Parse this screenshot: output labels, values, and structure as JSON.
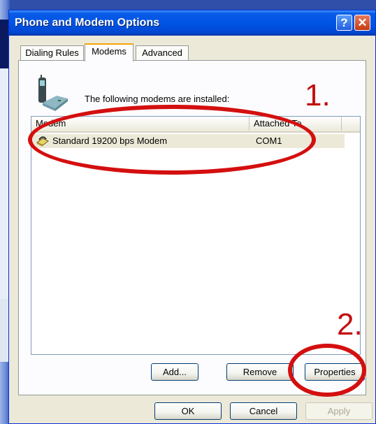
{
  "window": {
    "title": "Phone and Modem Options",
    "help_glyph": "?",
    "close_glyph": "✕"
  },
  "tabs": [
    {
      "label": "Dialing Rules",
      "active": false
    },
    {
      "label": "Modems",
      "active": true
    },
    {
      "label": "Advanced",
      "active": false
    }
  ],
  "modems_panel": {
    "intro": "The following modems are  installed:",
    "columns": [
      "Modem",
      "Attached To"
    ],
    "rows": [
      {
        "modem": "Standard 19200 bps Modem",
        "attached_to": "COM1",
        "icon": "modem-icon"
      }
    ],
    "buttons": {
      "add": "Add...",
      "remove": "Remove",
      "properties": "Properties"
    }
  },
  "dialog_buttons": {
    "ok": "OK",
    "cancel": "Cancel",
    "apply": "Apply"
  },
  "annotations": {
    "step1": "1.",
    "step2": "2.",
    "color": "#d40f0f"
  },
  "icons": {
    "top": "phone-modem-icon"
  }
}
